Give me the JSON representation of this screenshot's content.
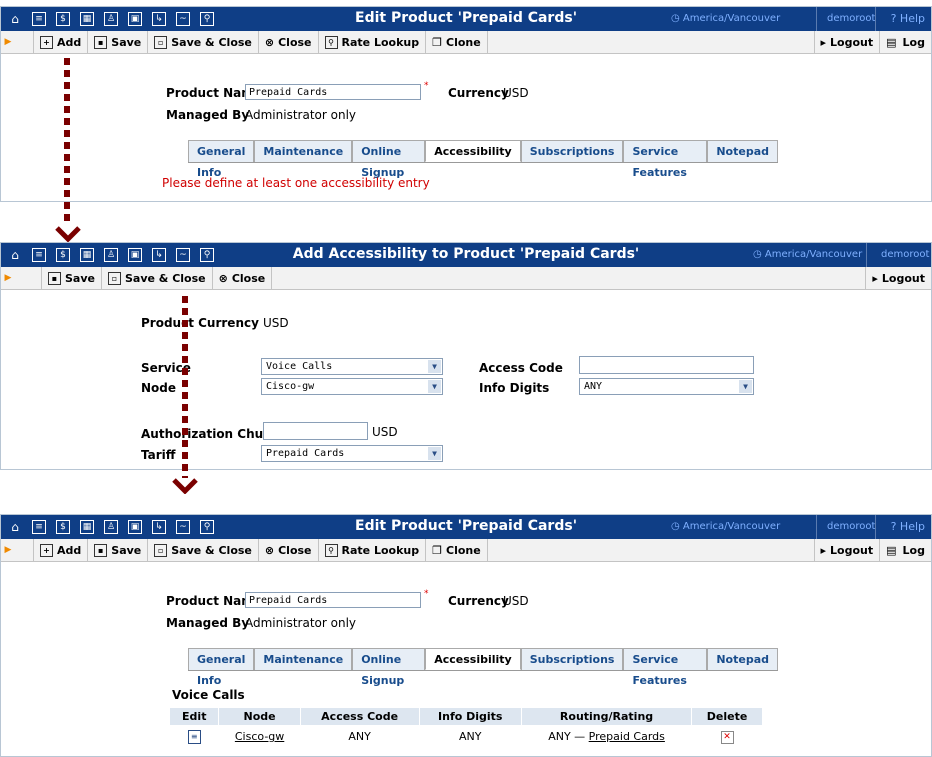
{
  "panel1": {
    "title": "Edit Product 'Prepaid Cards'",
    "timezone": "America/Vancouver",
    "user": "demoroot",
    "help": "Help",
    "toolbar": {
      "add": "Add",
      "save": "Save",
      "save_close": "Save & Close",
      "close": "Close",
      "rate_lookup": "Rate Lookup",
      "clone": "Clone",
      "logout": "Logout",
      "log": "Log"
    },
    "product_name_label": "Product Name",
    "product_name_value": "Prepaid Cards",
    "currency_label": "Currency",
    "currency_value": "USD",
    "managed_by_label": "Managed By",
    "managed_by_value": "Administrator only",
    "tabs": [
      "General Info",
      "Maintenance",
      "Online Signup",
      "Accessibility",
      "Subscriptions",
      "Service Features",
      "Notepad"
    ],
    "error": "Please define at least one accessibility entry"
  },
  "panel2": {
    "title": "Add Accessibility to Product 'Prepaid Cards'",
    "timezone": "America/Vancouver",
    "user": "demoroot",
    "toolbar": {
      "save": "Save",
      "save_close": "Save & Close",
      "close": "Close",
      "logout": "Logout"
    },
    "product_currency_label": "Product Currency",
    "product_currency_value": "USD",
    "service_label": "Service",
    "service_value": "Voice Calls",
    "node_label": "Node",
    "node_value": "Cisco-gw",
    "access_code_label": "Access Code",
    "access_code_value": "",
    "info_digits_label": "Info Digits",
    "info_digits_value": "ANY",
    "auth_chunk_label": "Authorization Chunk",
    "auth_chunk_value": "",
    "auth_chunk_unit": "USD",
    "tariff_label": "Tariff",
    "tariff_value": "Prepaid Cards"
  },
  "panel3": {
    "title": "Edit Product 'Prepaid Cards'",
    "timezone": "America/Vancouver",
    "user": "demoroot",
    "help": "Help",
    "toolbar": {
      "add": "Add",
      "save": "Save",
      "save_close": "Save & Close",
      "close": "Close",
      "rate_lookup": "Rate Lookup",
      "clone": "Clone",
      "logout": "Logout",
      "log": "Log"
    },
    "product_name_label": "Product Name",
    "product_name_value": "Prepaid Cards",
    "currency_label": "Currency",
    "currency_value": "USD",
    "managed_by_label": "Managed By",
    "managed_by_value": "Administrator only",
    "tabs": [
      "General Info",
      "Maintenance",
      "Online Signup",
      "Accessibility",
      "Subscriptions",
      "Service Features",
      "Notepad"
    ],
    "section_title": "Voice Calls",
    "table_headers": [
      "Edit",
      "Node",
      "Access Code",
      "Info Digits",
      "Routing/Rating",
      "Delete"
    ],
    "row": {
      "node": "Cisco-gw",
      "access_code": "ANY",
      "info_digits": "ANY",
      "routing_prefix": "ANY —",
      "routing_link": "Prepaid Cards"
    }
  }
}
